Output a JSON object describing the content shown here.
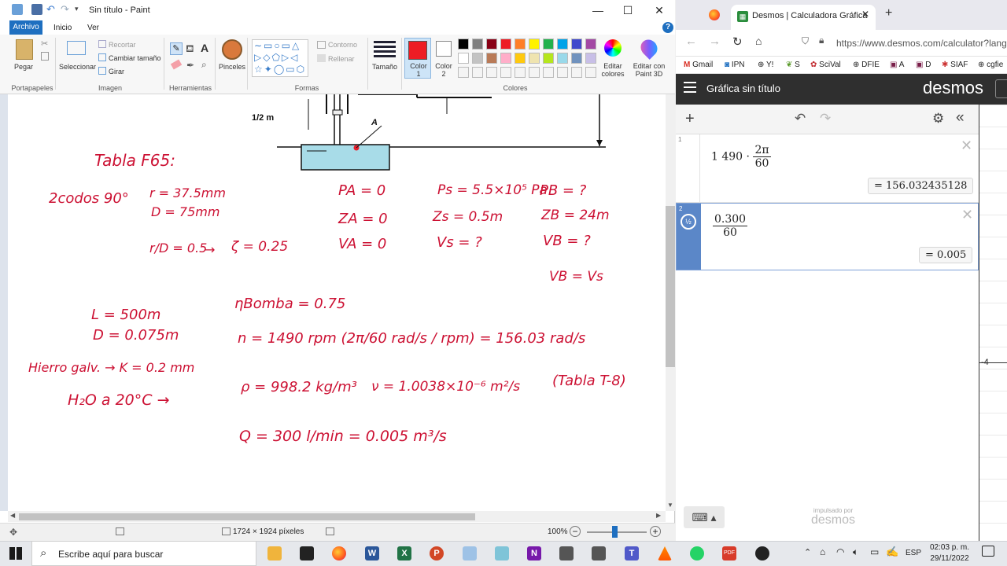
{
  "paint": {
    "title": "Sin título - Paint",
    "menu": {
      "file": "Archivo",
      "home": "Inicio",
      "view": "Ver"
    },
    "ribbon": {
      "paste": "Pegar",
      "cut": "Recortar",
      "select": "Seleccionar",
      "resize": "Cambiar tamaño",
      "rotate": "Girar",
      "brushes": "Pinceles",
      "outline": "Contorno",
      "fill": "Rellenar",
      "size": "Tamaño",
      "color1": "Color 1",
      "color2": "Color 2",
      "edit_colors": "Editar colores",
      "edit_paint3d": "Editar con Paint 3D",
      "groups": {
        "clipboard": "Portapapeles",
        "image": "Imagen",
        "tools": "Herramientas",
        "shapes": "Formas",
        "colors": "Colores"
      }
    },
    "colors": {
      "color1": "#ed1c24",
      "color2": "#ffffff",
      "palette_row1": [
        "#000000",
        "#7f7f7f",
        "#880015",
        "#ed1c24",
        "#ff7f27",
        "#fff200",
        "#22b14c",
        "#00a2e8",
        "#3f48cc",
        "#a349a4"
      ],
      "palette_row2": [
        "#ffffff",
        "#c3c3c3",
        "#b97a57",
        "#ffaec9",
        "#ffc90e",
        "#efe4b0",
        "#b5e61d",
        "#99d9ea",
        "#7092be",
        "#c8bfe7"
      ]
    },
    "canvas": {
      "diagram_label_height": "1/2 m",
      "diagram_label_point": "A",
      "table_title": "Tabla F65:",
      "elbows": "2codos 90°",
      "r": "r = 37.5mm",
      "D_fit": "D = 75mm",
      "ratio": "r/D = 0.5",
      "zeta": "ζ = 0.25",
      "PA": "PA = 0",
      "zA": "ZA = 0",
      "vA": "VA = 0",
      "Ps": "Ps = 5.5×10⁵ Pa",
      "zs": "Zs = 0.5m",
      "vs": "Vs = ?",
      "PB": "PB = ?",
      "zB": "ZB = 24m",
      "vB": "VB = ?",
      "vBvs": "VB = Vs",
      "L": "L = 500m",
      "D": "D = 0.075m",
      "rough": "Hierro galv. → K = 0.2 mm",
      "water": "H₂O a 20°C →",
      "eta": "ηBomba = 0.75",
      "n": "n = 1490 rpm (2π/60 rad/s / rpm) = 156.03 rad/s",
      "rho": "ρ = 998.2 kg/m³",
      "nu": "ν = 1.0038×10⁻⁶ m²/s",
      "table_ref": "(Tabla T-8)",
      "Q": "Q = 300 l/min = 0.005 m³/s"
    },
    "status": {
      "dimensions": "1724 × 1924 píxeles",
      "zoom": "100%"
    }
  },
  "browser": {
    "tab_title": "Desmos | Calculadora Gráfica",
    "url": "https://www.desmos.com/calculator?lang=",
    "bookmarks": [
      "Gmail",
      "IPN",
      "Y!",
      "S",
      "SciVal",
      "DFIE",
      "A",
      "D",
      "SIAF",
      "cgfie"
    ]
  },
  "desmos": {
    "graph_title": "Gráfica sin título",
    "logo": "desmos",
    "footer_powered": "impulsado por",
    "footer_logo": "desmos",
    "axis_tick": "-4",
    "expressions": [
      {
        "index": "1",
        "lhs": "1 490 ·",
        "num": "2π",
        "den": "60",
        "result": "= 156.032435128"
      },
      {
        "index": "2",
        "lhs": "",
        "num": "0.300",
        "den": "60",
        "result": "= 0.005"
      }
    ]
  },
  "taskbar": {
    "search_placeholder": "Escribe aquí para buscar",
    "lang": "ESP",
    "time": "02:03 p. m.",
    "date": "29/11/2022"
  }
}
